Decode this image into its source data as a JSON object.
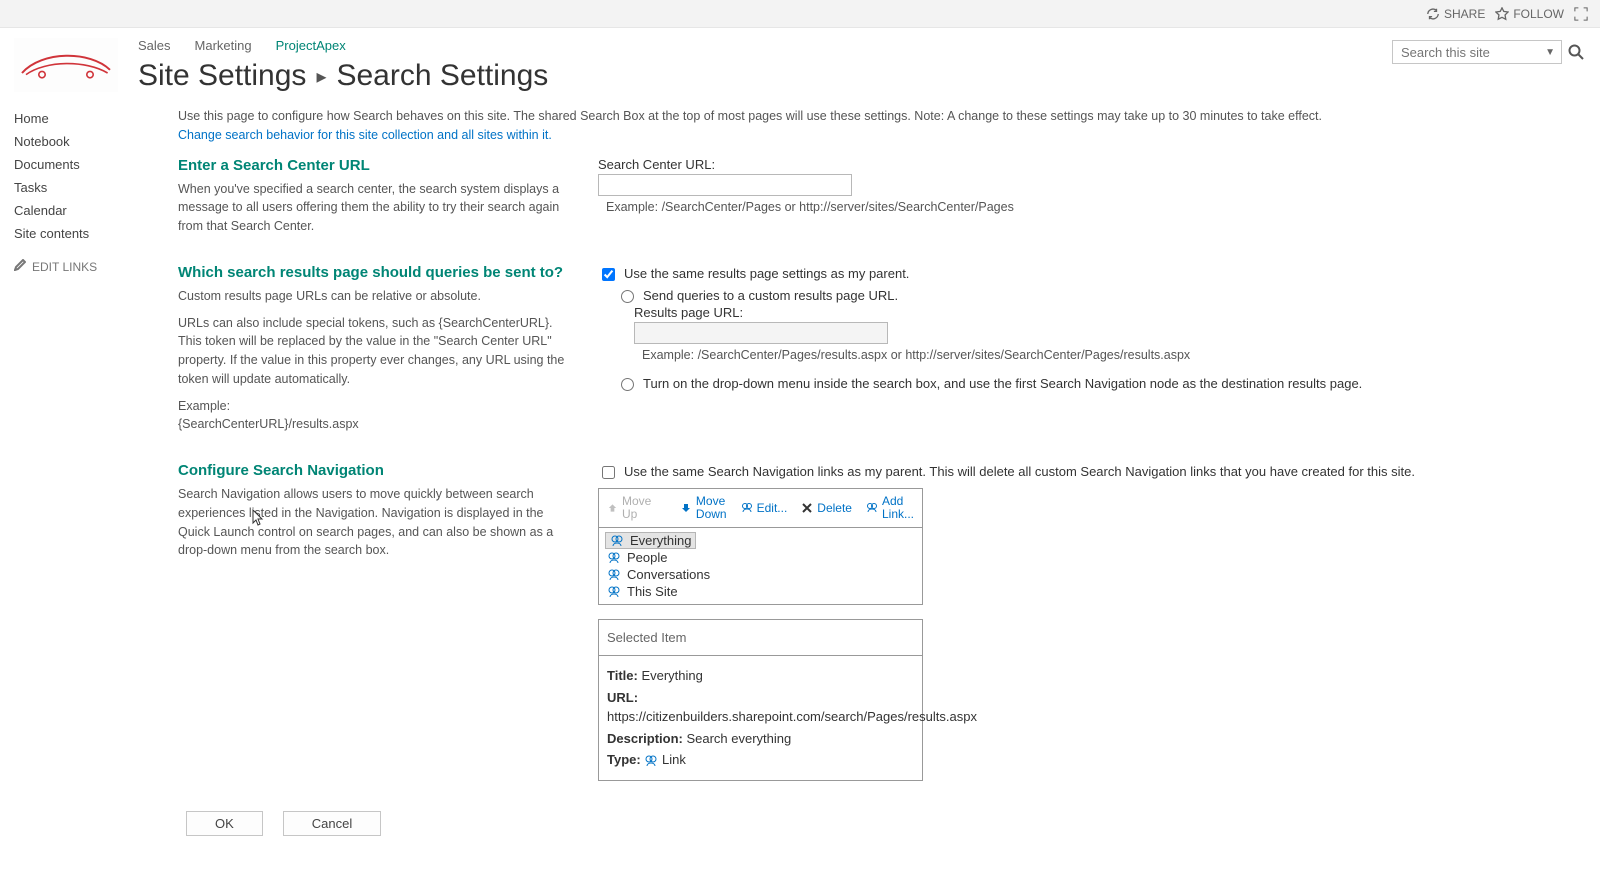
{
  "topbar": {
    "share": "SHARE",
    "follow": "FOLLOW"
  },
  "topnav": {
    "items": [
      {
        "label": "Sales"
      },
      {
        "label": "Marketing"
      },
      {
        "label": "ProjectApex",
        "active": true
      }
    ]
  },
  "breadcrumb": {
    "parent": "Site Settings",
    "current": "Search Settings"
  },
  "search": {
    "placeholder": "Search this site"
  },
  "leftnav": {
    "items": [
      {
        "label": "Home"
      },
      {
        "label": "Notebook"
      },
      {
        "label": "Documents"
      },
      {
        "label": "Tasks"
      },
      {
        "label": "Calendar"
      },
      {
        "label": "Site contents"
      }
    ],
    "edit": "EDIT LINKS"
  },
  "intro": {
    "text": "Use this page to configure how Search behaves on this site. The shared Search Box at the top of most pages will use these settings. Note: A change to these settings may take up to 30 minutes to take effect.",
    "link": "Change search behavior for this site collection and all sites within it."
  },
  "section1": {
    "title": "Enter a Search Center URL",
    "desc": "When you've specified a search center, the search system displays a message to all users offering them the ability to try their search again from that Search Center.",
    "label": "Search Center URL:",
    "example": "Example: /SearchCenter/Pages or http://server/sites/SearchCenter/Pages"
  },
  "section2": {
    "title": "Which search results page should queries be sent to?",
    "desc1": "Custom results page URLs can be relative or absolute.",
    "desc2": "URLs can also include special tokens, such as {SearchCenterURL}. This token will be replaced by the value in the \"Search Center URL\" property. If the value in this property ever changes, any URL using the token will update automatically.",
    "desc3a": "Example:",
    "desc3b": "{SearchCenterURL}/results.aspx",
    "opt_parent": "Use the same results page settings as my parent.",
    "opt_custom": "Send queries to a custom results page URL.",
    "results_label": "Results page URL:",
    "results_example": "Example: /SearchCenter/Pages/results.aspx or http://server/sites/SearchCenter/Pages/results.aspx",
    "opt_dropdown": "Turn on the drop-down menu inside the search box, and use the first Search Navigation node as the destination results page."
  },
  "section3": {
    "title": "Configure Search Navigation",
    "desc": "Search Navigation allows users to move quickly between search experiences listed in the Navigation. Navigation is displayed in the Quick Launch control on search pages, and can also be shown as a drop-down menu from the search box.",
    "parent_check": "Use the same Search Navigation links as my parent. This will delete all custom Search Navigation links that you have created for this site.",
    "toolbar": {
      "moveup": "Move Up",
      "movedown": "Move\nDown",
      "edit": "Edit...",
      "delete": "Delete",
      "addlink": "Add\nLink..."
    },
    "navitems": [
      {
        "label": "Everything",
        "selected": true
      },
      {
        "label": "People"
      },
      {
        "label": "Conversations"
      },
      {
        "label": "This Site"
      }
    ],
    "selected_header": "Selected Item",
    "selected": {
      "title_label": "Title:",
      "title_value": "Everything",
      "url_label": "URL:",
      "url_value": "https://citizenbuilders.sharepoint.com/search/Pages/results.aspx",
      "desc_label": "Description:",
      "desc_value": "Search everything",
      "type_label": "Type:",
      "type_value": "Link"
    }
  },
  "buttons": {
    "ok": "OK",
    "cancel": "Cancel"
  }
}
